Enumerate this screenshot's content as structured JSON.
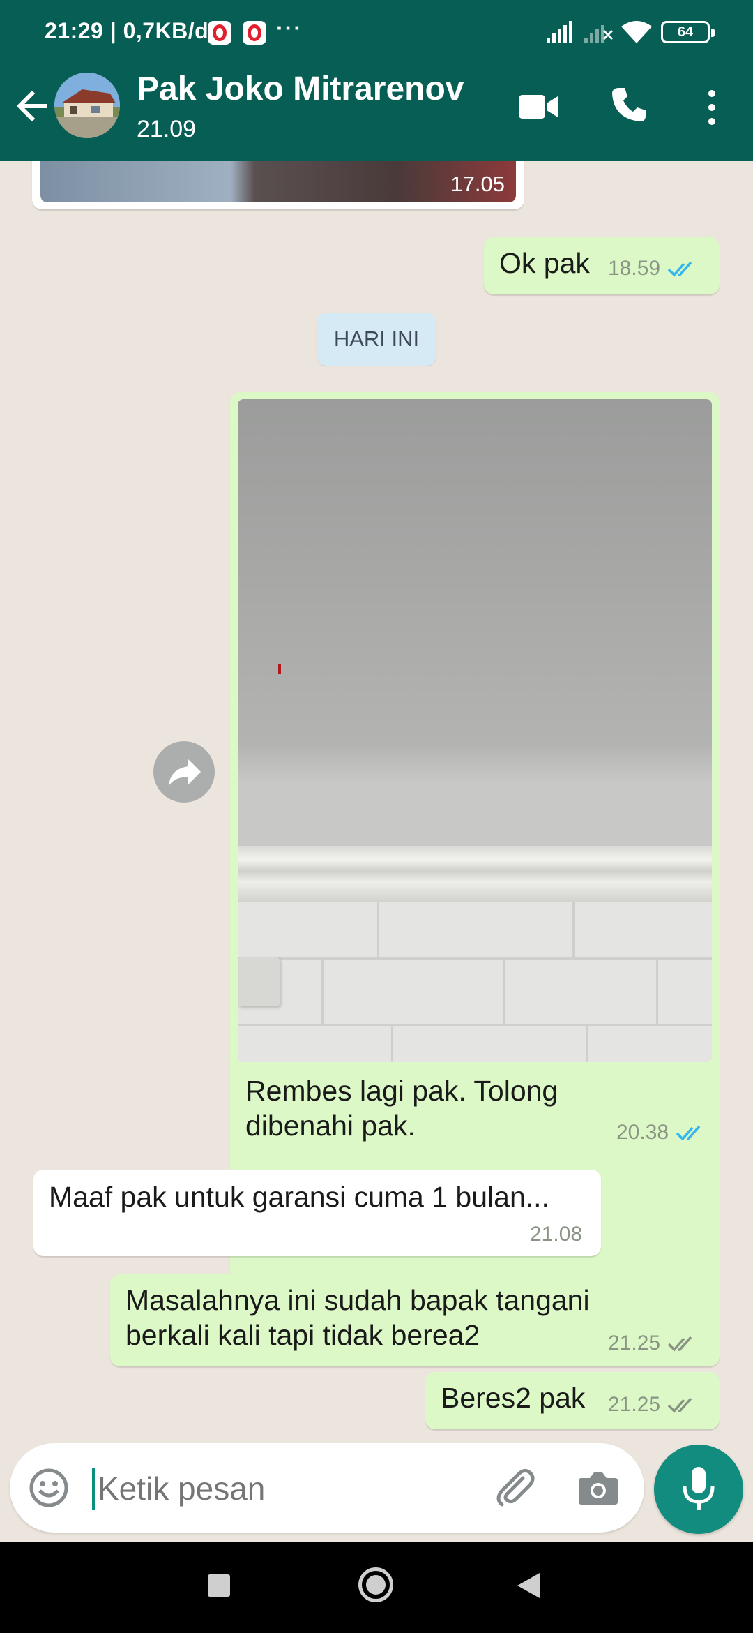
{
  "status_bar": {
    "time_net": "21:29 | 0,7KB/d",
    "more": "···",
    "battery": "64"
  },
  "header": {
    "contact_name": "Pak Joko Mitrarenov",
    "subtitle": "21.09"
  },
  "chat": {
    "prev_photo_time": "17.05",
    "date_divider": "HARI INI",
    "messages": [
      {
        "direction": "outgoing",
        "text": "Ok pak",
        "time": "18.59",
        "status": "read"
      },
      {
        "direction": "outgoing",
        "type": "photo",
        "caption_line1": "Rembes lagi pak. Tolong",
        "caption_line2": "dibenahi pak.",
        "time": "20.38",
        "status": "read"
      },
      {
        "direction": "incoming",
        "text": "Maaf pak untuk garansi cuma 1 bulan...",
        "time": "21.08"
      },
      {
        "direction": "outgoing",
        "line1": "Masalahnya ini sudah bapak tangani",
        "line2": "berkali kali tapi tidak berea2",
        "time": "21.25",
        "status": "delivered"
      },
      {
        "direction": "outgoing",
        "text": "Beres2 pak",
        "time": "21.25",
        "status": "delivered"
      }
    ]
  },
  "composer": {
    "placeholder": "Ketik pesan"
  },
  "colors": {
    "header": "#075e54",
    "outgoing_bubble": "#dcf8c6",
    "incoming_bubble": "#ffffff",
    "read_ticks": "#34b7f1",
    "delivered_ticks": "#8a9485",
    "mic_button": "#128c7e"
  }
}
